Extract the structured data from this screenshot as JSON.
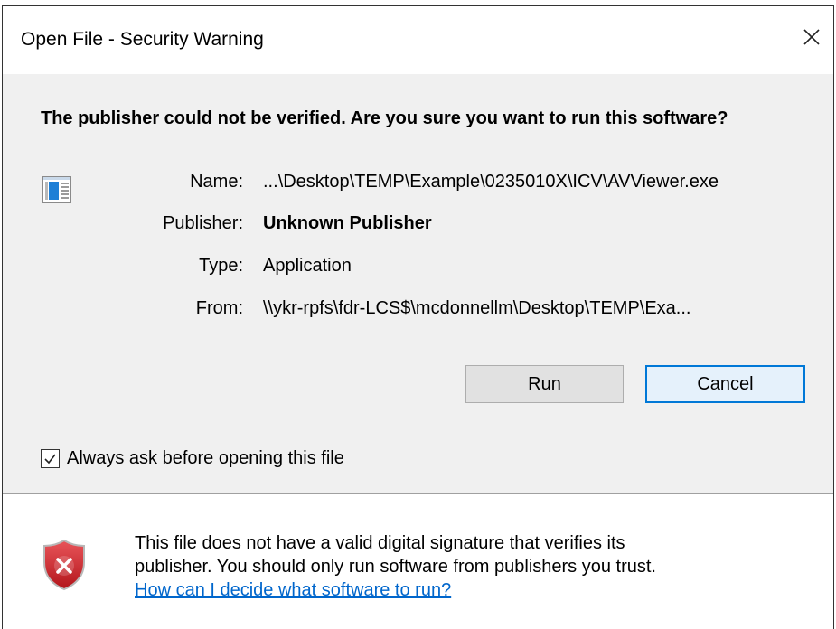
{
  "window": {
    "title": "Open File - Security Warning",
    "close_icon": "close-icon"
  },
  "headline": "The publisher could not be verified.  Are you sure you want to run this software?",
  "file_icon": "application-window-icon",
  "details": {
    "name_label": "Name:",
    "name_value": "...\\Desktop\\TEMP\\Example\\0235010X\\ICV\\AVViewer.exe",
    "publisher_label": "Publisher:",
    "publisher_value": "Unknown Publisher",
    "type_label": "Type:",
    "type_value": "Application",
    "from_label": "From:",
    "from_value": "\\\\ykr-rpfs\\fdr-LCS$\\mcdonnellm\\Desktop\\TEMP\\Exa..."
  },
  "buttons": {
    "run_label": "Run",
    "cancel_label": "Cancel"
  },
  "checkbox": {
    "label": "Always ask before opening this file",
    "checked": true
  },
  "footer": {
    "icon": "error-shield-icon",
    "line1": "This file does not have a valid digital signature that verifies its",
    "line2": "publisher.  You should only run software from publishers you trust.",
    "link_text": "How can I decide what software to run?"
  },
  "colors": {
    "accent": "#0078d7",
    "link": "#0066cc",
    "shield_red": "#d13438"
  }
}
